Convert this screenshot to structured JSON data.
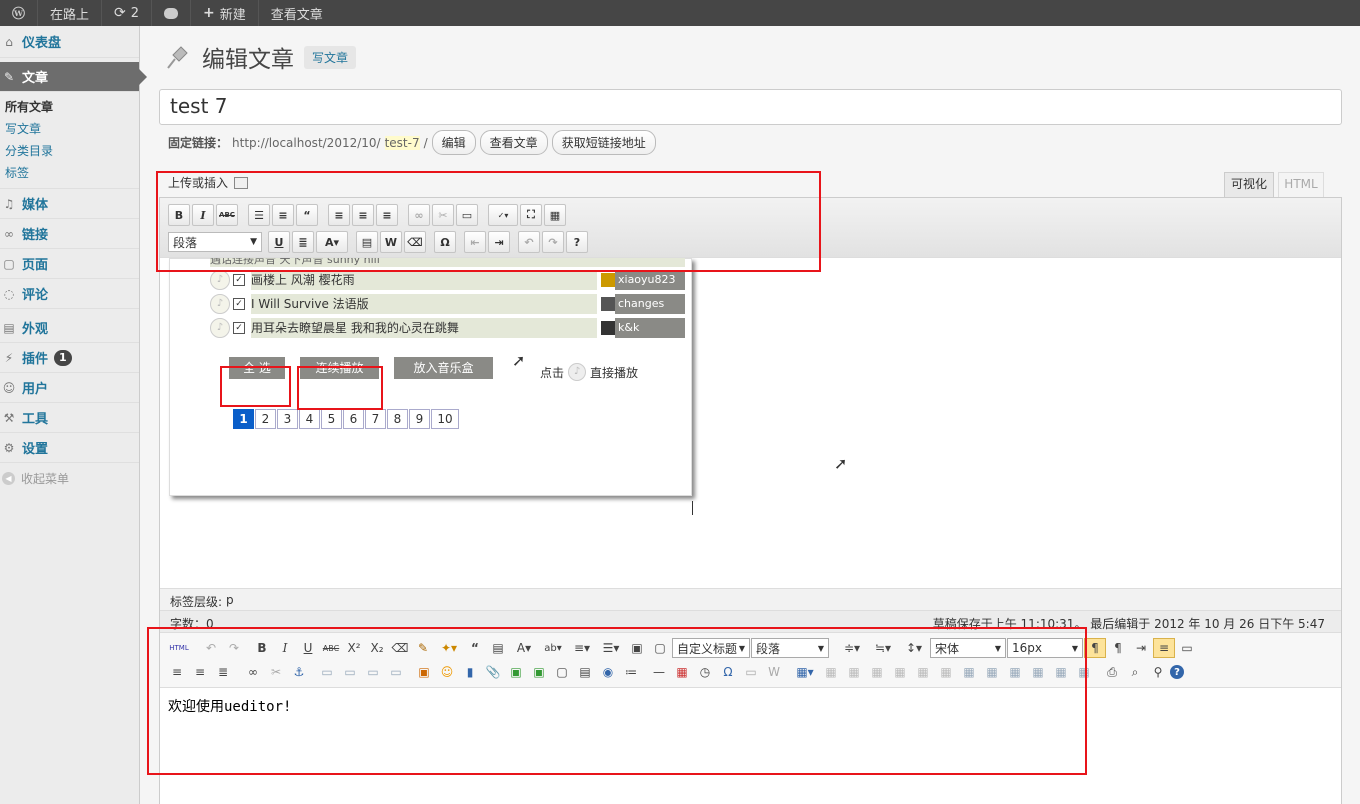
{
  "admin_bar": {
    "site_name": "在路上",
    "updates_count": "2",
    "new_label": "新建",
    "view_post": "查看文章"
  },
  "sidebar": {
    "dashboard": "仪表盘",
    "posts": "文章",
    "posts_sub": [
      "所有文章",
      "写文章",
      "分类目录",
      "标签"
    ],
    "media": "媒体",
    "links": "链接",
    "pages": "页面",
    "comments": "评论",
    "appearance": "外观",
    "plugins": "插件",
    "plugins_badge": "1",
    "users": "用户",
    "tools": "工具",
    "settings": "设置",
    "collapse": "收起菜单"
  },
  "page": {
    "title": "编辑文章",
    "add_new": "写文章"
  },
  "post_title": "test 7",
  "permalink": {
    "label": "固定链接：",
    "url_base": "http://localhost/2012/10/",
    "slug": "test-7",
    "trail": "/",
    "edit_btn": "编辑",
    "view_btn": "查看文章",
    "shortlink_btn": "获取短链接地址"
  },
  "editor": {
    "upload_label": "上传或插入",
    "tab_visual": "可视化",
    "tab_html": "HTML",
    "format_select": "段落",
    "path_label": "标签层级:",
    "path_value": "p",
    "word_count": "字数：0",
    "autosave": "草稿保存于上午 11:10:31。 最后编辑于 2012 年 10 月 26 日下午 5:47"
  },
  "music": {
    "top_row_text": "遇话连接声音 天下声音 sunny hill",
    "rows": [
      {
        "song": "画楼上 风潮 樱花雨",
        "user": "xiaoyu823"
      },
      {
        "song": "I Will Survive 法语版",
        "user": "changes"
      },
      {
        "song": "用耳朵去瞭望晨星 我和我的心灵在跳舞",
        "user": "k&k"
      }
    ],
    "select_all": "全 选",
    "continuous_play": "连续播放",
    "add_to_box": "放入音乐盒",
    "click_label": "点击",
    "direct_play": "直接播放",
    "pages": [
      "1",
      "2",
      "3",
      "4",
      "5",
      "6",
      "7",
      "8",
      "9",
      "10"
    ]
  },
  "ueditor": {
    "custom_heading": "自定义标题",
    "paragraph": "段落",
    "font_family": "宋体",
    "font_size": "16px",
    "content": "欢迎使用ueditor!",
    "html_btn": "HTML"
  },
  "colors": {
    "annotation_red": "#e8141a",
    "link_blue": "#21759b",
    "admin_bar": "#464646",
    "pager_active": "#0a5ec9"
  }
}
